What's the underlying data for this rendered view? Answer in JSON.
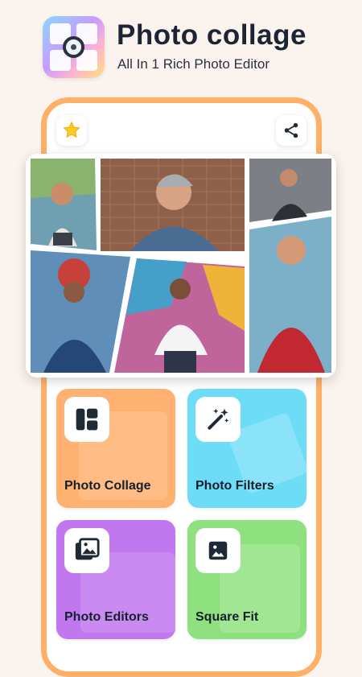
{
  "header": {
    "title": "Photo collage",
    "subtitle": "All In 1 Rich Photo Editor"
  },
  "icons": {
    "logo": "camera-collage-icon",
    "rate": "star-icon",
    "share": "share-icon"
  },
  "tiles": [
    {
      "label": "Photo Collage",
      "icon": "collage-layout-icon",
      "color": "#ffb172"
    },
    {
      "label": "Photo Filters",
      "icon": "magic-wand-icon",
      "color": "#6ddcf6"
    },
    {
      "label": "Photo Editors",
      "icon": "photos-stack-icon",
      "color": "#c178ee"
    },
    {
      "label": "Square Fit",
      "icon": "image-icon",
      "color": "#8fe07f"
    }
  ],
  "colors": {
    "background": "#fbf4ee",
    "phone_border": "#ffb066",
    "title_text": "#1d2434"
  }
}
